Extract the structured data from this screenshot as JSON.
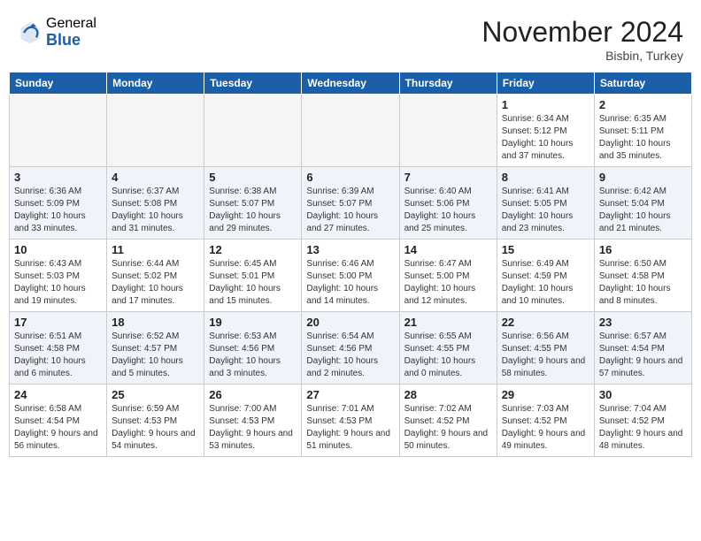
{
  "header": {
    "logo_general": "General",
    "logo_blue": "Blue",
    "month_title": "November 2024",
    "location": "Bisbin, Turkey"
  },
  "calendar": {
    "days_of_week": [
      "Sunday",
      "Monday",
      "Tuesday",
      "Wednesday",
      "Thursday",
      "Friday",
      "Saturday"
    ],
    "weeks": [
      [
        {
          "day": "",
          "info": ""
        },
        {
          "day": "",
          "info": ""
        },
        {
          "day": "",
          "info": ""
        },
        {
          "day": "",
          "info": ""
        },
        {
          "day": "",
          "info": ""
        },
        {
          "day": "1",
          "info": "Sunrise: 6:34 AM\nSunset: 5:12 PM\nDaylight: 10 hours and 37 minutes."
        },
        {
          "day": "2",
          "info": "Sunrise: 6:35 AM\nSunset: 5:11 PM\nDaylight: 10 hours and 35 minutes."
        }
      ],
      [
        {
          "day": "3",
          "info": "Sunrise: 6:36 AM\nSunset: 5:09 PM\nDaylight: 10 hours and 33 minutes."
        },
        {
          "day": "4",
          "info": "Sunrise: 6:37 AM\nSunset: 5:08 PM\nDaylight: 10 hours and 31 minutes."
        },
        {
          "day": "5",
          "info": "Sunrise: 6:38 AM\nSunset: 5:07 PM\nDaylight: 10 hours and 29 minutes."
        },
        {
          "day": "6",
          "info": "Sunrise: 6:39 AM\nSunset: 5:07 PM\nDaylight: 10 hours and 27 minutes."
        },
        {
          "day": "7",
          "info": "Sunrise: 6:40 AM\nSunset: 5:06 PM\nDaylight: 10 hours and 25 minutes."
        },
        {
          "day": "8",
          "info": "Sunrise: 6:41 AM\nSunset: 5:05 PM\nDaylight: 10 hours and 23 minutes."
        },
        {
          "day": "9",
          "info": "Sunrise: 6:42 AM\nSunset: 5:04 PM\nDaylight: 10 hours and 21 minutes."
        }
      ],
      [
        {
          "day": "10",
          "info": "Sunrise: 6:43 AM\nSunset: 5:03 PM\nDaylight: 10 hours and 19 minutes."
        },
        {
          "day": "11",
          "info": "Sunrise: 6:44 AM\nSunset: 5:02 PM\nDaylight: 10 hours and 17 minutes."
        },
        {
          "day": "12",
          "info": "Sunrise: 6:45 AM\nSunset: 5:01 PM\nDaylight: 10 hours and 15 minutes."
        },
        {
          "day": "13",
          "info": "Sunrise: 6:46 AM\nSunset: 5:00 PM\nDaylight: 10 hours and 14 minutes."
        },
        {
          "day": "14",
          "info": "Sunrise: 6:47 AM\nSunset: 5:00 PM\nDaylight: 10 hours and 12 minutes."
        },
        {
          "day": "15",
          "info": "Sunrise: 6:49 AM\nSunset: 4:59 PM\nDaylight: 10 hours and 10 minutes."
        },
        {
          "day": "16",
          "info": "Sunrise: 6:50 AM\nSunset: 4:58 PM\nDaylight: 10 hours and 8 minutes."
        }
      ],
      [
        {
          "day": "17",
          "info": "Sunrise: 6:51 AM\nSunset: 4:58 PM\nDaylight: 10 hours and 6 minutes."
        },
        {
          "day": "18",
          "info": "Sunrise: 6:52 AM\nSunset: 4:57 PM\nDaylight: 10 hours and 5 minutes."
        },
        {
          "day": "19",
          "info": "Sunrise: 6:53 AM\nSunset: 4:56 PM\nDaylight: 10 hours and 3 minutes."
        },
        {
          "day": "20",
          "info": "Sunrise: 6:54 AM\nSunset: 4:56 PM\nDaylight: 10 hours and 2 minutes."
        },
        {
          "day": "21",
          "info": "Sunrise: 6:55 AM\nSunset: 4:55 PM\nDaylight: 10 hours and 0 minutes."
        },
        {
          "day": "22",
          "info": "Sunrise: 6:56 AM\nSunset: 4:55 PM\nDaylight: 9 hours and 58 minutes."
        },
        {
          "day": "23",
          "info": "Sunrise: 6:57 AM\nSunset: 4:54 PM\nDaylight: 9 hours and 57 minutes."
        }
      ],
      [
        {
          "day": "24",
          "info": "Sunrise: 6:58 AM\nSunset: 4:54 PM\nDaylight: 9 hours and 56 minutes."
        },
        {
          "day": "25",
          "info": "Sunrise: 6:59 AM\nSunset: 4:53 PM\nDaylight: 9 hours and 54 minutes."
        },
        {
          "day": "26",
          "info": "Sunrise: 7:00 AM\nSunset: 4:53 PM\nDaylight: 9 hours and 53 minutes."
        },
        {
          "day": "27",
          "info": "Sunrise: 7:01 AM\nSunset: 4:53 PM\nDaylight: 9 hours and 51 minutes."
        },
        {
          "day": "28",
          "info": "Sunrise: 7:02 AM\nSunset: 4:52 PM\nDaylight: 9 hours and 50 minutes."
        },
        {
          "day": "29",
          "info": "Sunrise: 7:03 AM\nSunset: 4:52 PM\nDaylight: 9 hours and 49 minutes."
        },
        {
          "day": "30",
          "info": "Sunrise: 7:04 AM\nSunset: 4:52 PM\nDaylight: 9 hours and 48 minutes."
        }
      ]
    ]
  }
}
